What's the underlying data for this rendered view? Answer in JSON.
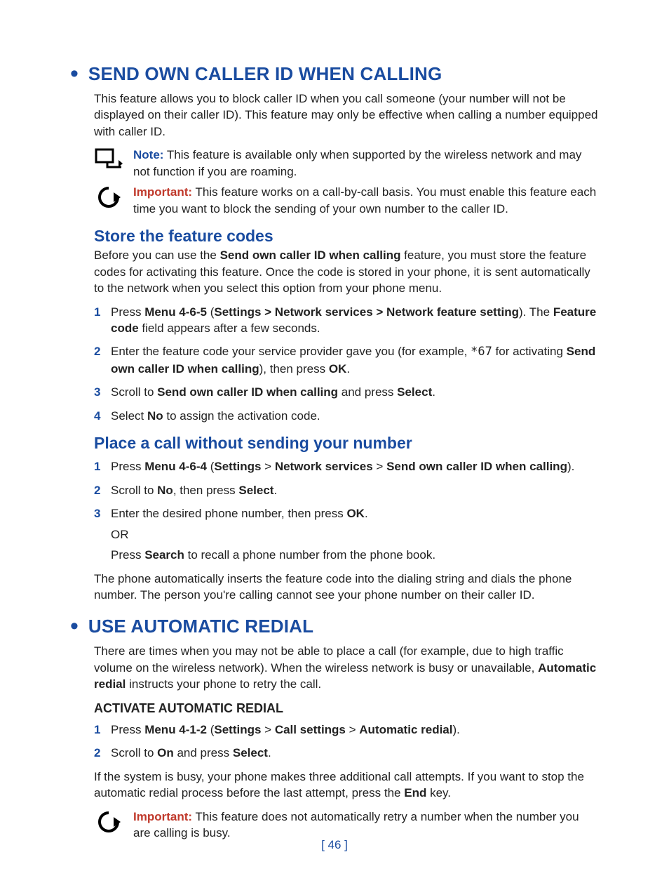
{
  "page_number": "[ 46 ]",
  "sec1": {
    "title": "SEND OWN CALLER ID WHEN CALLING",
    "intro": "This feature allows you to block caller ID when you call someone (your number will not be displayed on their caller ID). This feature may only be effective when calling a number equipped with caller ID.",
    "note": {
      "label": "Note:",
      "text": " This feature is available only when supported by the wireless network and may not function if you are roaming."
    },
    "important": {
      "label": "Important:",
      "text": " This feature works on a call-by-call basis. You must enable this feature each time you want to block the sending of your own number to the caller ID."
    }
  },
  "store": {
    "title": "Store the feature codes",
    "intro_a": "Before you can use the ",
    "intro_b": "Send own caller ID when calling",
    "intro_c": " feature, you must store the feature codes for activating this feature. Once the code is stored in your phone, it is sent automatically to the network when you select this option from your phone menu.",
    "steps": {
      "s1": {
        "a": "Press ",
        "b": "Menu 4-6-5",
        "c": " (",
        "d": "Settings > Network services > Network feature setting",
        "e": "). The ",
        "f": "Feature code",
        "g": " field appears after a few seconds."
      },
      "s2": {
        "a": "Enter the feature code your service provider gave you (for example, ",
        "code": "*67",
        "b": " for activating ",
        "c": "Send own caller ID when calling",
        "d": "), then press ",
        "e": "OK",
        "f": "."
      },
      "s3": {
        "a": "Scroll to ",
        "b": "Send own caller ID when calling",
        "c": " and press ",
        "d": "Select",
        "e": "."
      },
      "s4": {
        "a": "Select ",
        "b": "No",
        "c": " to assign the activation code."
      }
    }
  },
  "place": {
    "title": "Place a call without sending your number",
    "steps": {
      "s1": {
        "a": "Press ",
        "b": "Menu 4-6-4",
        "c": " (",
        "d": "Settings",
        "gt1": " > ",
        "e": "Network services",
        "gt2": " > ",
        "f": "Send own caller ID when calling",
        "g": ")."
      },
      "s2": {
        "a": "Scroll to ",
        "b": "No",
        "c": ", then press ",
        "d": "Select",
        "e": "."
      },
      "s3": {
        "a": "Enter the desired phone number, then press ",
        "b": "OK",
        "c": ".",
        "or": "OR",
        "sub_a": "Press ",
        "sub_b": "Search",
        "sub_c": " to recall a phone number from the phone book."
      }
    },
    "outro": "The phone automatically inserts the feature code into the dialing string and dials the phone number. The person you're calling cannot see your phone number on their caller ID."
  },
  "sec2": {
    "title": "USE AUTOMATIC REDIAL",
    "intro_a": "There are times when you may not be able to place a call (for example, due to high traffic volume on the wireless network). When the wireless network is busy or unavailable, ",
    "intro_b": "Automatic redial",
    "intro_c": " instructs your phone to retry the call."
  },
  "activate": {
    "title": "ACTIVATE AUTOMATIC REDIAL",
    "steps": {
      "s1": {
        "a": "Press ",
        "b": "Menu 4-1-2",
        "c": " (",
        "d": "Settings",
        "gt1": " > ",
        "e": "Call settings",
        "gt2": " > ",
        "f": "Automatic redial",
        "g": ")."
      },
      "s2": {
        "a": "Scroll to ",
        "b": "On",
        "c": " and press ",
        "d": "Select",
        "e": "."
      }
    },
    "outro_a": "If the system is busy, your phone makes three additional call attempts. If you want to stop the automatic redial process before the last attempt, press the ",
    "outro_b": "End",
    "outro_c": " key.",
    "important": {
      "label": "Important:",
      "text": " This feature does not automatically retry a number when the number you are calling is busy."
    }
  }
}
